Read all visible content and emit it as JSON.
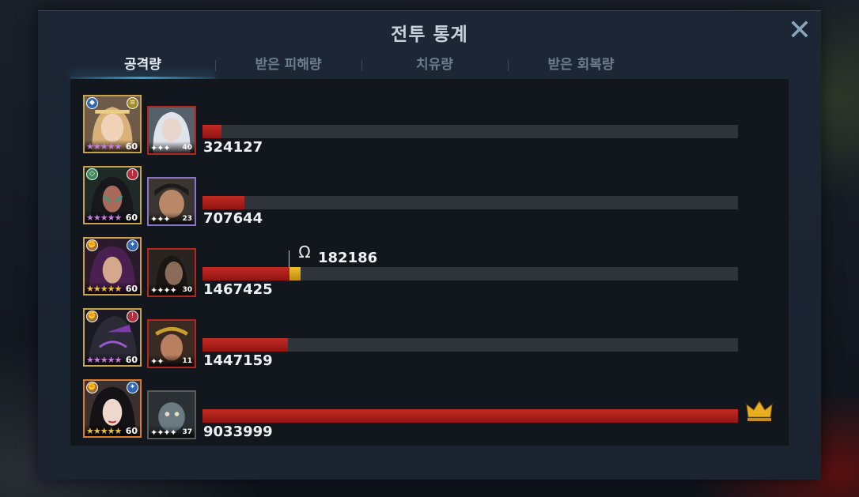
{
  "header": {
    "title": "전투 통계",
    "close_glyph": "✕"
  },
  "tabs": [
    {
      "label": "공격량",
      "active": true
    },
    {
      "label": "받은 피해량",
      "active": false
    },
    {
      "label": "치유량",
      "active": false
    },
    {
      "label": "받은 회복량",
      "active": false
    }
  ],
  "rows": [
    {
      "hero": {
        "stars": "★★★★★",
        "star_color": "#c77de0",
        "level": "60",
        "badge_left": "shield-icon",
        "badge_right": "gold-gear-icon",
        "frame_color": "#c8a24a"
      },
      "pet": {
        "stars": "✦✦✦",
        "level": "40",
        "frame_color": "#b32620"
      },
      "damage": "324127",
      "fraction": 0.036
    },
    {
      "hero": {
        "stars": "★★★★★",
        "star_color": "#c77de0",
        "level": "60",
        "badge_left": "diamond-icon",
        "badge_right": "fire-icon",
        "frame_color": "#c8a24a"
      },
      "pet": {
        "stars": "✦✦✦",
        "level": "23",
        "frame_color": "#8a74c8"
      },
      "damage": "707644",
      "fraction": 0.078
    },
    {
      "hero": {
        "stars": "★★★★★",
        "star_color": "#e8c24a",
        "level": "60",
        "badge_left": "fist-icon",
        "badge_right": "sparkle-icon",
        "frame_color": "#c8a24a"
      },
      "pet": {
        "stars": "✦✦✦✦",
        "level": "30",
        "frame_color": "#b32620"
      },
      "damage": "1467425",
      "fraction": 0.162,
      "pet_damage": "182186",
      "pet_fraction": 0.02
    },
    {
      "hero": {
        "stars": "★★★★★",
        "star_color": "#c77de0",
        "level": "60",
        "badge_left": "fist-icon",
        "badge_right": "fire-icon",
        "frame_color": "#c8a24a"
      },
      "pet": {
        "stars": "✦✦",
        "level": "11",
        "frame_color": "#b32620"
      },
      "damage": "1447159",
      "fraction": 0.16
    },
    {
      "hero": {
        "stars": "★★★★★",
        "star_color": "#e8c24a",
        "level": "60",
        "badge_left": "fist-icon",
        "badge_right": "sparkle-icon",
        "frame_color": "#e07a2a"
      },
      "pet": {
        "stars": "✦✦✦✦",
        "level": "37",
        "frame_color": "#b32620"
      },
      "damage": "9033999",
      "fraction": 1.0,
      "top_dealer": true
    }
  ],
  "colors": {
    "bar_fill": "#b01f1b",
    "bar_track": "#30353c",
    "pet_bar": "#f0c030",
    "crown": "#e8b020"
  }
}
